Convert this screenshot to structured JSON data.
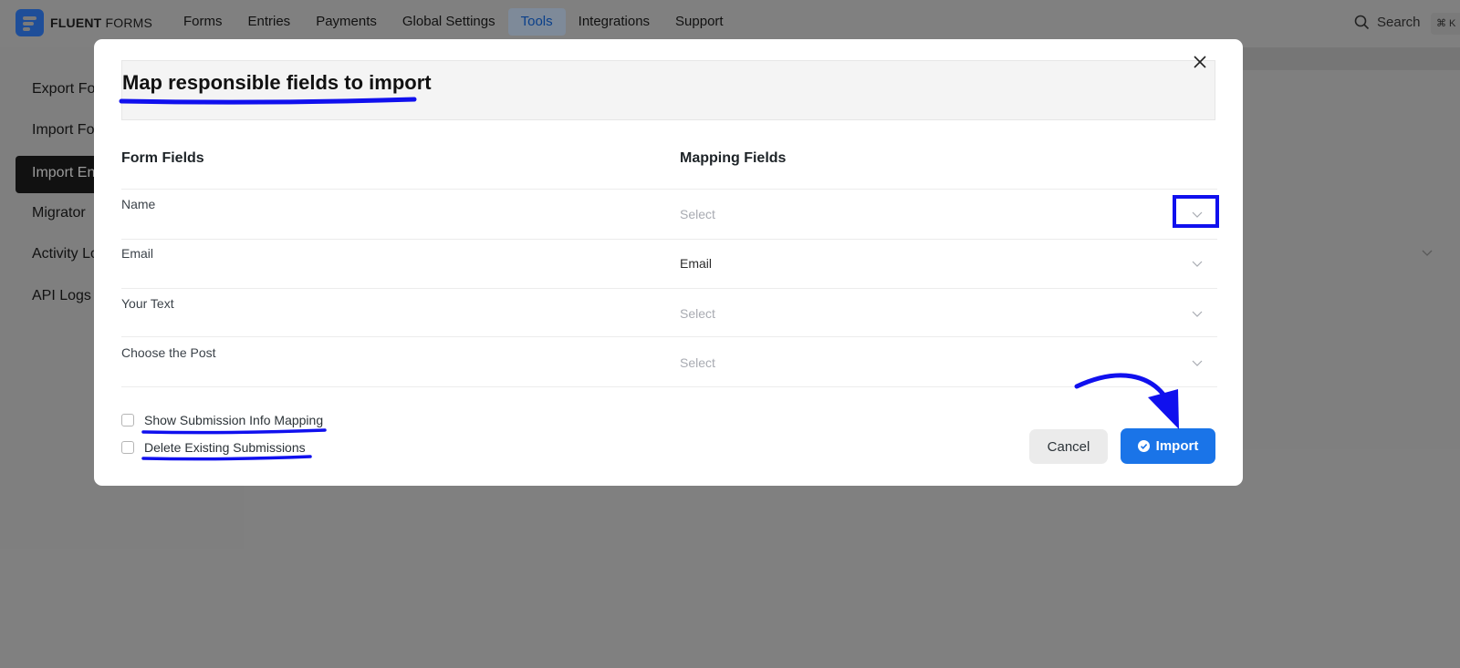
{
  "app": {
    "logo_bold": "FLUENT",
    "logo_rest": " FORMS"
  },
  "nav": {
    "items": [
      {
        "label": "Forms"
      },
      {
        "label": "Entries"
      },
      {
        "label": "Payments"
      },
      {
        "label": "Global Settings"
      },
      {
        "label": "Tools",
        "active": true
      },
      {
        "label": "Integrations"
      },
      {
        "label": "Support"
      }
    ],
    "search_label": "Search",
    "shortcut": "⌘ K"
  },
  "sidebar": {
    "items": [
      {
        "label": "Export Fo"
      },
      {
        "label": "Import Fo"
      },
      {
        "label": "Import En",
        "active": true
      },
      {
        "label": "Migrator"
      },
      {
        "label": "Activity Lo"
      },
      {
        "label": "API Logs"
      }
    ]
  },
  "modal": {
    "title": "Map responsible fields to import",
    "form_fields_header": "Form Fields",
    "mapping_fields_header": "Mapping Fields",
    "rows": [
      {
        "field": "Name",
        "mapping": "Select",
        "selected": false
      },
      {
        "field": "Email",
        "mapping": "Email",
        "selected": true
      },
      {
        "field": "Your Text",
        "mapping": "Select",
        "selected": false
      },
      {
        "field": "Choose the Post",
        "mapping": "Select",
        "selected": false
      }
    ],
    "options": {
      "show_submission_info": "Show Submission Info Mapping",
      "delete_existing": "Delete Existing Submissions"
    },
    "cancel_label": "Cancel",
    "import_label": "Import"
  },
  "colors": {
    "overlay": "#808080",
    "primary": "#1a74e8",
    "annotation": "#1010ee"
  }
}
